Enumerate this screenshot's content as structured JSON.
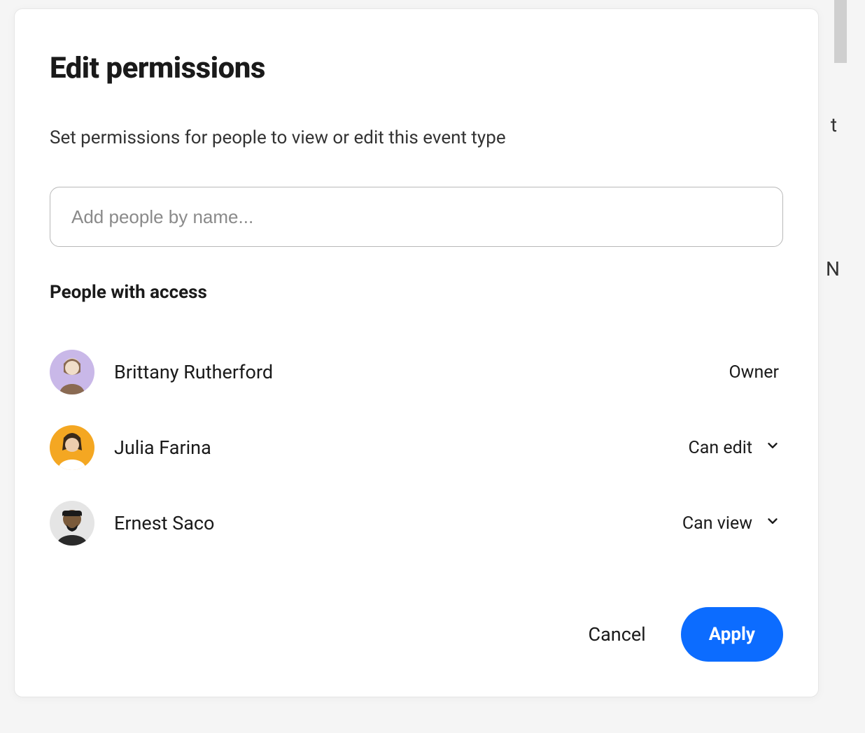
{
  "modal": {
    "title": "Edit permissions",
    "subtitle": "Set permissions for people to view or edit this event type",
    "add_placeholder": "Add people by name...",
    "section_heading": "People with access"
  },
  "people": [
    {
      "name": "Brittany Rutherford",
      "permission": "Owner",
      "has_dropdown": false,
      "avatar_bg": "#c9b8e8"
    },
    {
      "name": "Julia Farina",
      "permission": "Can edit",
      "has_dropdown": true,
      "avatar_bg": "#f4a722"
    },
    {
      "name": "Ernest Saco",
      "permission": "Can view",
      "has_dropdown": true,
      "avatar_bg": "#e5e5e5"
    }
  ],
  "buttons": {
    "cancel": "Cancel",
    "apply": "Apply"
  },
  "colors": {
    "primary": "#0c6cff"
  }
}
